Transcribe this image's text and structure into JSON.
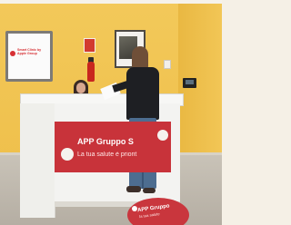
{
  "signage": {
    "tv_screen_text": "Smart Clinic by Apple Group",
    "counter_banner_title": "APP Gruppo S",
    "counter_banner_subtitle": "La tua salute è priorit",
    "floor_sticker_title": "APP Gruppo",
    "floor_sticker_subtitle": "la tua salute"
  },
  "colors": {
    "wall": "#efc04c",
    "brand_red": "#c8333a",
    "counter_white": "#f3f3f1"
  }
}
